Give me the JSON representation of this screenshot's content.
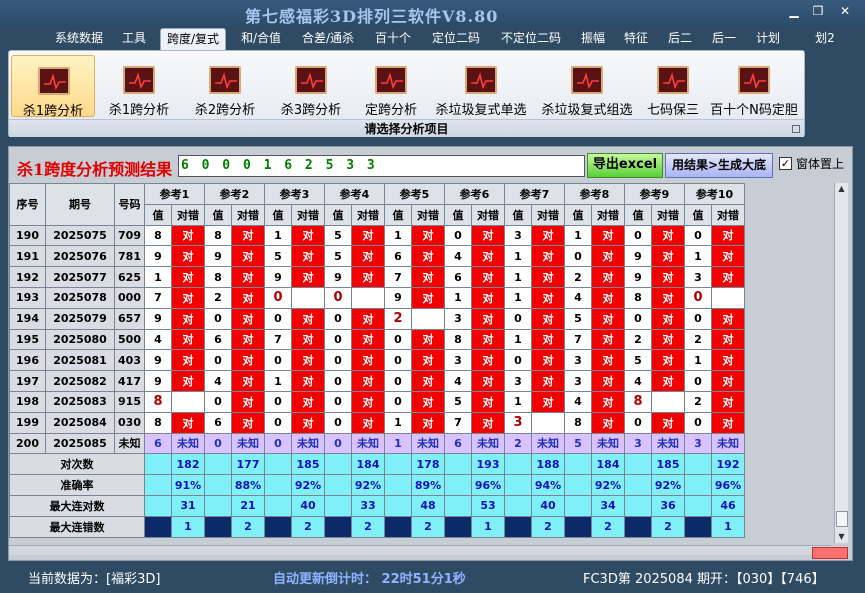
{
  "window": {
    "title": "第七感福彩3D排列三软件V8.80",
    "controls": [
      "▁",
      "❐",
      "✕"
    ]
  },
  "menu": [
    "系统数据",
    "工具",
    "跨度/复式",
    "和/合值",
    "合差/通杀",
    "百十个",
    "定位二码",
    "不定位二码",
    "振幅",
    "特征",
    "后二",
    "后一",
    "计划",
    "划2"
  ],
  "menu_active_index": 2,
  "ribbon": {
    "buttons": [
      "杀1跨分析",
      "杀1跨分析",
      "杀2跨分析",
      "杀3跨分析",
      "定跨分析",
      "杀垃圾复式单选",
      "杀垃圾复式组选",
      "七码保三",
      "百十个N码定胆"
    ],
    "selected_index": 0,
    "caption": "请选择分析项目"
  },
  "panel": {
    "title": "杀1跨度分析预测结果",
    "result_numbers": "6 0 0 0 1 6 2 5 3 3",
    "export_button": "导出excel",
    "generate_button": "用结果>生成大底",
    "topmost_checkbox": {
      "label": "窗体置上",
      "checked": true,
      "mark": "✓"
    }
  },
  "table": {
    "headers": {
      "seq": "序号",
      "period": "期号",
      "number": "号码"
    },
    "groups": [
      "参考1",
      "参考2",
      "参考3",
      "参考4",
      "参考5",
      "参考6",
      "参考7",
      "参考8",
      "参考9",
      "参考10"
    ],
    "sub_headers": [
      "值",
      "对错"
    ],
    "right_label": "对",
    "rows": [
      {
        "seq": "190",
        "period": "2025075",
        "number": "709",
        "values": [
          "8",
          "8",
          "1",
          "5",
          "1",
          "0",
          "3",
          "1",
          "0",
          "0"
        ],
        "ok": [
          1,
          1,
          1,
          1,
          1,
          1,
          1,
          1,
          1,
          1
        ]
      },
      {
        "seq": "191",
        "period": "2025076",
        "number": "781",
        "values": [
          "9",
          "9",
          "5",
          "5",
          "6",
          "4",
          "1",
          "0",
          "9",
          "1"
        ],
        "ok": [
          1,
          1,
          1,
          1,
          1,
          1,
          1,
          1,
          1,
          1
        ]
      },
      {
        "seq": "192",
        "period": "2025077",
        "number": "625",
        "values": [
          "1",
          "8",
          "9",
          "9",
          "7",
          "6",
          "1",
          "2",
          "9",
          "3"
        ],
        "ok": [
          1,
          1,
          1,
          1,
          1,
          1,
          1,
          1,
          1,
          1
        ]
      },
      {
        "seq": "193",
        "period": "2025078",
        "number": "000",
        "values": [
          "7",
          "2",
          "0",
          "0",
          "9",
          "1",
          "1",
          "4",
          "8",
          "0"
        ],
        "ok": [
          1,
          1,
          0,
          0,
          1,
          1,
          1,
          1,
          1,
          0
        ]
      },
      {
        "seq": "194",
        "period": "2025079",
        "number": "657",
        "values": [
          "9",
          "0",
          "0",
          "0",
          "2",
          "3",
          "0",
          "5",
          "0",
          "0"
        ],
        "ok": [
          1,
          1,
          1,
          1,
          0,
          1,
          1,
          1,
          1,
          1
        ]
      },
      {
        "seq": "195",
        "period": "2025080",
        "number": "500",
        "values": [
          "4",
          "6",
          "7",
          "0",
          "0",
          "8",
          "1",
          "7",
          "2",
          "2"
        ],
        "ok": [
          1,
          1,
          1,
          1,
          1,
          1,
          1,
          1,
          1,
          1
        ]
      },
      {
        "seq": "196",
        "period": "2025081",
        "number": "403",
        "values": [
          "9",
          "0",
          "0",
          "0",
          "0",
          "3",
          "0",
          "3",
          "5",
          "1"
        ],
        "ok": [
          1,
          1,
          1,
          1,
          1,
          1,
          1,
          1,
          1,
          1
        ]
      },
      {
        "seq": "197",
        "period": "2025082",
        "number": "417",
        "values": [
          "9",
          "4",
          "1",
          "0",
          "0",
          "4",
          "3",
          "3",
          "4",
          "0"
        ],
        "ok": [
          1,
          1,
          1,
          1,
          1,
          1,
          1,
          1,
          1,
          1
        ]
      },
      {
        "seq": "198",
        "period": "2025083",
        "number": "915",
        "values": [
          "8",
          "0",
          "0",
          "0",
          "0",
          "5",
          "1",
          "4",
          "8",
          "2"
        ],
        "ok": [
          0,
          1,
          1,
          1,
          1,
          1,
          1,
          1,
          0,
          1
        ]
      },
      {
        "seq": "199",
        "period": "2025084",
        "number": "030",
        "values": [
          "8",
          "6",
          "0",
          "0",
          "1",
          "7",
          "3",
          "8",
          "0",
          "0"
        ],
        "ok": [
          1,
          1,
          1,
          1,
          1,
          1,
          0,
          1,
          1,
          1
        ]
      }
    ],
    "prediction": {
      "seq": "200",
      "period": "2025085",
      "number": "未知",
      "values": [
        "6",
        "0",
        "0",
        "0",
        "1",
        "6",
        "2",
        "5",
        "3",
        "3"
      ],
      "status": "未知"
    },
    "stats": [
      {
        "label": "对次数",
        "values": [
          "182",
          "177",
          "185",
          "184",
          "178",
          "193",
          "188",
          "184",
          "185",
          "192"
        ]
      },
      {
        "label": "准确率",
        "values": [
          "91%",
          "88%",
          "92%",
          "92%",
          "89%",
          "96%",
          "94%",
          "92%",
          "92%",
          "96%"
        ]
      },
      {
        "label": "最大连对数",
        "values": [
          "31",
          "21",
          "40",
          "33",
          "48",
          "53",
          "40",
          "34",
          "36",
          "46"
        ]
      },
      {
        "label": "最大连错数",
        "values": [
          "1",
          "2",
          "2",
          "2",
          "2",
          "1",
          "2",
          "2",
          "2",
          "1"
        ]
      }
    ]
  },
  "status_bar": {
    "current_data": "当前数据为：[福彩3D]",
    "countdown": "自动更新倒计时：  22时51分1秒",
    "latest": "FC3D第 2025084 期开：【030】【746】"
  },
  "colors": {
    "correct_red": "#f20000",
    "prediction_purple": "#d8c2ff",
    "stats_cyan": "#7ff0f8",
    "panel_title_red": "#e00000",
    "numbers_green": "#008000"
  },
  "icons": {
    "ribbon_icon": "chart-monitor-icon"
  }
}
